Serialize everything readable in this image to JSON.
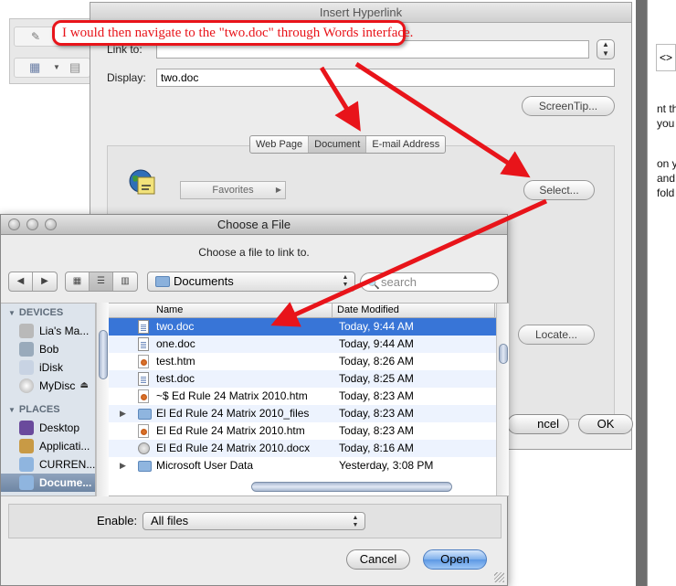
{
  "annotation": "I would then navigate to the \"two.doc\" through Words interface.",
  "insert_hyperlink": {
    "title": "Insert Hyperlink",
    "link_to_label": "Link to:",
    "link_to_value": "",
    "display_label": "Display:",
    "display_value": "two.doc",
    "screentip_label": "ScreenTip...",
    "tabs": [
      "Web Page",
      "Document",
      "E-mail Address"
    ],
    "favorites_label": "Favorites",
    "select_label": "Select...",
    "locate_label": "Locate...",
    "cancel_label": "ncel",
    "ok_label": "OK"
  },
  "choose_file": {
    "title": "Choose a File",
    "subtitle": "Choose a file to link to.",
    "path": "Documents",
    "search_placeholder": "search",
    "sidebar": {
      "devices_header": "DEVICES",
      "devices": [
        "Lia's Ma...",
        "Bob",
        "iDisk",
        "MyDisc"
      ],
      "places_header": "PLACES",
      "places": [
        "Desktop",
        "Applicati...",
        "CURREN...",
        "Docume..."
      ]
    },
    "columns": {
      "name": "Name",
      "date": "Date Modified"
    },
    "files": [
      {
        "name": "two.doc",
        "date": "Today, 9:44 AM",
        "kind": "doc",
        "expandable": false,
        "selected": true
      },
      {
        "name": "one.doc",
        "date": "Today, 9:44 AM",
        "kind": "doc",
        "expandable": false,
        "selected": false
      },
      {
        "name": "test.htm",
        "date": "Today, 8:26 AM",
        "kind": "htm",
        "expandable": false,
        "selected": false
      },
      {
        "name": "test.doc",
        "date": "Today, 8:25 AM",
        "kind": "doc",
        "expandable": false,
        "selected": false
      },
      {
        "name": "~$ Ed Rule 24 Matrix 2010.htm",
        "date": "Today, 8:23 AM",
        "kind": "htm",
        "expandable": false,
        "selected": false
      },
      {
        "name": "El Ed Rule 24 Matrix 2010_files",
        "date": "Today, 8:23 AM",
        "kind": "folder",
        "expandable": true,
        "selected": false
      },
      {
        "name": "El Ed Rule 24 Matrix 2010.htm",
        "date": "Today, 8:23 AM",
        "kind": "htm",
        "expandable": false,
        "selected": false
      },
      {
        "name": "El Ed Rule 24 Matrix 2010.docx",
        "date": "Today, 8:16 AM",
        "kind": "mixed",
        "expandable": false,
        "selected": false
      },
      {
        "name": "Microsoft User Data",
        "date": "Yesterday, 3:08 PM",
        "kind": "folder",
        "expandable": true,
        "selected": false
      }
    ],
    "enable_label": "Enable:",
    "enable_value": "All files",
    "cancel_label": "Cancel",
    "open_label": "Open"
  },
  "right_edge_text": [
    "<>",
    "nt th",
    "you",
    "on y",
    "and",
    "fold"
  ],
  "colors": {
    "annotation_red": "#e8141a",
    "selection_blue": "#3875d7",
    "sidebar_bg": "#dde4ec"
  }
}
